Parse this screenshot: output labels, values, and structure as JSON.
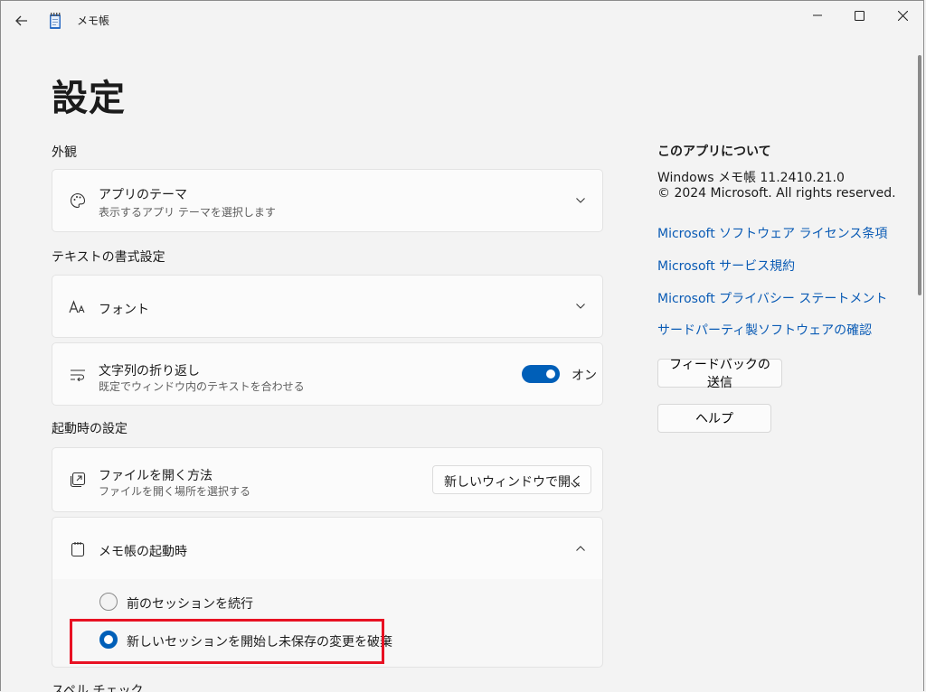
{
  "titlebar": {
    "app_name": "メモ帳",
    "back_icon": "back-arrow-icon",
    "app_icon": "notepad-icon"
  },
  "page": {
    "title": "設定"
  },
  "sections": {
    "appearance": "外観",
    "text_format": "テキストの書式設定",
    "startup": "起動時の設定",
    "spellcheck": "スペル チェック"
  },
  "theme": {
    "title": "アプリのテーマ",
    "subtitle": "表示するアプリ テーマを選択します",
    "icon": "palette-icon"
  },
  "font": {
    "title": "フォント",
    "icon": "font-icon"
  },
  "word_wrap": {
    "title": "文字列の折り返し",
    "subtitle": "既定でウィンドウ内のテキストを合わせる",
    "state_label": "オン",
    "on": true,
    "icon": "wrap-icon"
  },
  "open_file": {
    "title": "ファイルを開く方法",
    "subtitle": "ファイルを開く場所を選択する",
    "selected": "新しいウィンドウで開く",
    "icon": "open-file-icon"
  },
  "startup_behavior": {
    "title": "メモ帳の起動時",
    "icon": "notepad-outline-icon",
    "options": [
      {
        "label": "前のセッションを続行",
        "selected": false
      },
      {
        "label": "新しいセッションを開始し未保存の変更を破棄",
        "selected": true
      }
    ]
  },
  "about": {
    "title": "このアプリについて",
    "version": "Windows メモ帳 11.2410.21.0",
    "copyright": "© 2024 Microsoft. All rights reserved.",
    "links": [
      "Microsoft ソフトウェア ライセンス条項",
      "Microsoft サービス規約",
      "Microsoft プライバシー ステートメント",
      "サードパーティ製ソフトウェアの確認"
    ],
    "feedback_button": "フィードバックの送信",
    "help_button": "ヘルプ"
  },
  "colors": {
    "accent": "#005fb8",
    "link": "#0a5bb5",
    "highlight": "#e81123"
  }
}
